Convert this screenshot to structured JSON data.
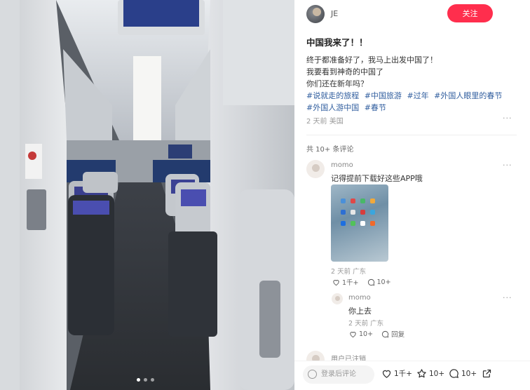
{
  "author": {
    "name": "JE",
    "follow_label": "关注"
  },
  "post": {
    "title": "中国我来了！！",
    "lines": [
      "终于都准备好了，我马上出发中国了！",
      "我要看到神奇的中国了",
      "你们还在新年吗？"
    ],
    "tags": [
      "#说就走的旅程",
      "#中国旅游",
      "#过年",
      "#外国人眼里的春节",
      "#外国人游中国",
      "#春节"
    ],
    "meta": "2 天前 美国"
  },
  "comments": {
    "count_label": "共 10+ 条评论",
    "items": [
      {
        "name": "momo",
        "text": "记得提前下载好这些APP哦",
        "meta": "2 天前 广东",
        "likes": "1千+",
        "replies": "10+"
      },
      {
        "name": "momo",
        "text": "你上去",
        "meta": "2 天前 广东",
        "likes": "10+",
        "reply_label": "回复"
      }
    ],
    "partial_label": "用户已注销"
  },
  "bottom_bar": {
    "input_placeholder": "登录后评论",
    "likes": "1千+",
    "favorites": "10+",
    "comments": "10+"
  },
  "icons": [
    "more-icon",
    "heart-icon",
    "star-icon",
    "comment-icon",
    "share-icon",
    "user-icon"
  ],
  "colors": {
    "follow": "#ff2e4d",
    "tag": "#2f5d9e"
  }
}
